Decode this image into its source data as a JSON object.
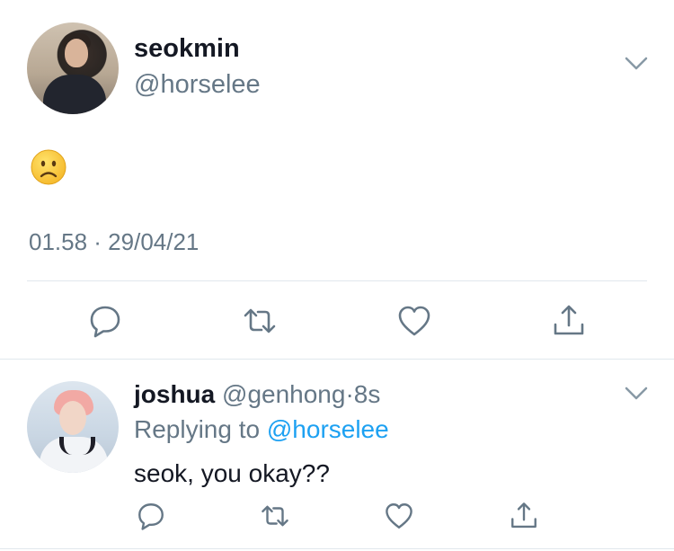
{
  "tweet": {
    "display_name": "seokmin",
    "handle": "@horselee",
    "emoji": "☹️",
    "timestamp": "01.58 · 29/04/21",
    "avatar_icon": "user-avatar-photo",
    "menu_icon": "chevron-down-icon"
  },
  "actions": {
    "reply_icon": "reply-icon",
    "retweet_icon": "retweet-icon",
    "like_icon": "like-heart-icon",
    "share_icon": "share-icon",
    "icon_color": "#657786"
  },
  "reply": {
    "display_name": "joshua",
    "handle": "@genhong",
    "separator": "·",
    "time_ago": "8s",
    "replying_to_label": "Replying to",
    "replying_to_handle": "@horselee",
    "text": "seok, you okay??"
  },
  "colors": {
    "text": "#141823",
    "secondary": "#657786",
    "link": "#1da1f2",
    "divider": "#e1e8ed"
  }
}
